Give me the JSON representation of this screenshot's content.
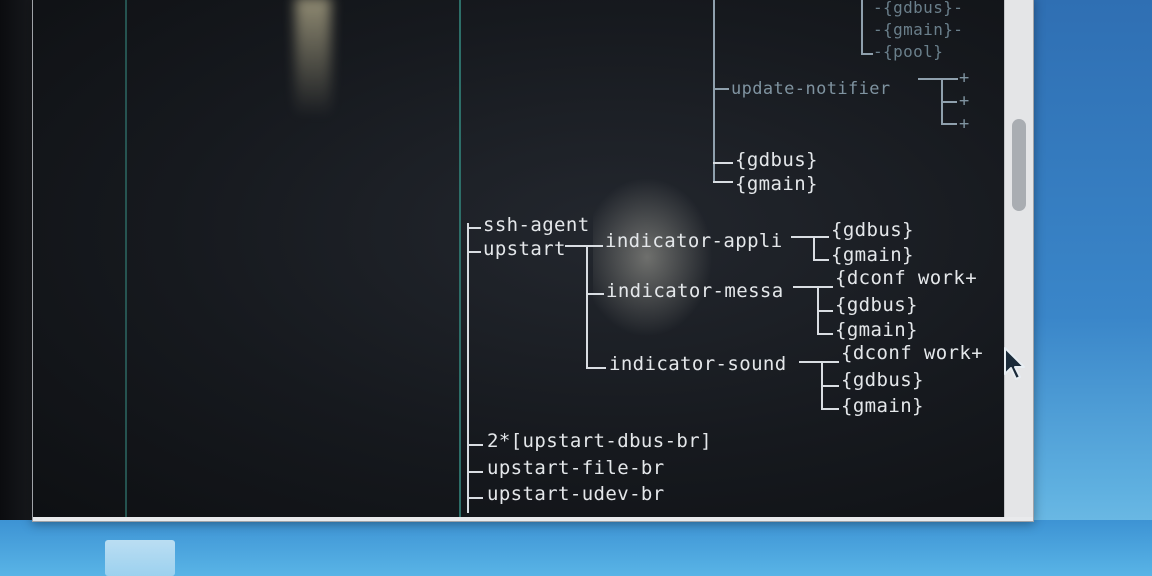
{
  "terminal": {
    "tree": {
      "top_faint": [
        "-{gdbus}-",
        "-{gmain}-",
        "-{pool}"
      ],
      "update_notifier": "update-notifier",
      "update_notifier_children": [
        "+",
        "+",
        "+"
      ],
      "upper_children": [
        "{gdbus}",
        "{gmain}"
      ],
      "ssh_agent": "ssh-agent",
      "upstart": "upstart",
      "indicator_appli": "indicator-appli",
      "indicator_appli_children": [
        "{gdbus}",
        "{gmain}"
      ],
      "indicator_messa": "indicator-messa",
      "indicator_messa_children": [
        "{dconf work+",
        "{gdbus}",
        "{gmain}"
      ],
      "indicator_sound": "indicator-sound",
      "indicator_sound_children": [
        "{dconf work+",
        "{gdbus}",
        "{gmain}"
      ],
      "upstart_dbus": "2*[upstart-dbus-br]",
      "upstart_file": "upstart-file-br",
      "upstart_udev": "upstart-udev-br"
    }
  },
  "colors": {
    "terminal_bg": "#16191e",
    "text": "#e4e7ea",
    "pane_border": "#2d6e68",
    "desktop": "#3a86c9"
  },
  "icons": [
    "mouse-cursor-icon"
  ]
}
